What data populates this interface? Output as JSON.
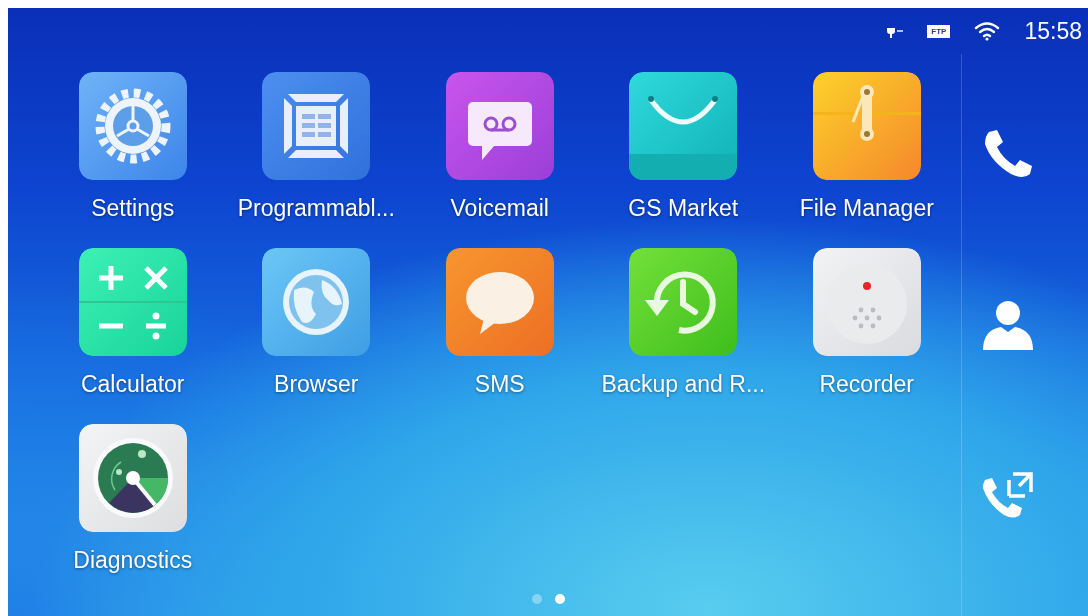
{
  "status_bar": {
    "ftp_label": "FTP",
    "time": "15:58"
  },
  "apps": [
    {
      "label": "Settings",
      "kind": "settings"
    },
    {
      "label": "Programmabl...",
      "kind": "programmable"
    },
    {
      "label": "Voicemail",
      "kind": "voicemail"
    },
    {
      "label": "GS Market",
      "kind": "market"
    },
    {
      "label": "File Manager",
      "kind": "files"
    },
    {
      "label": "Calculator",
      "kind": "calculator"
    },
    {
      "label": "Browser",
      "kind": "browser"
    },
    {
      "label": "SMS",
      "kind": "sms"
    },
    {
      "label": "Backup and R...",
      "kind": "backup"
    },
    {
      "label": "Recorder",
      "kind": "recorder"
    },
    {
      "label": "Diagnostics",
      "kind": "diagnostics"
    }
  ],
  "dock": [
    {
      "kind": "phone"
    },
    {
      "kind": "contacts"
    },
    {
      "kind": "transfer"
    }
  ],
  "page_indicator": [
    {
      "selected": false
    },
    {
      "selected": true
    }
  ]
}
